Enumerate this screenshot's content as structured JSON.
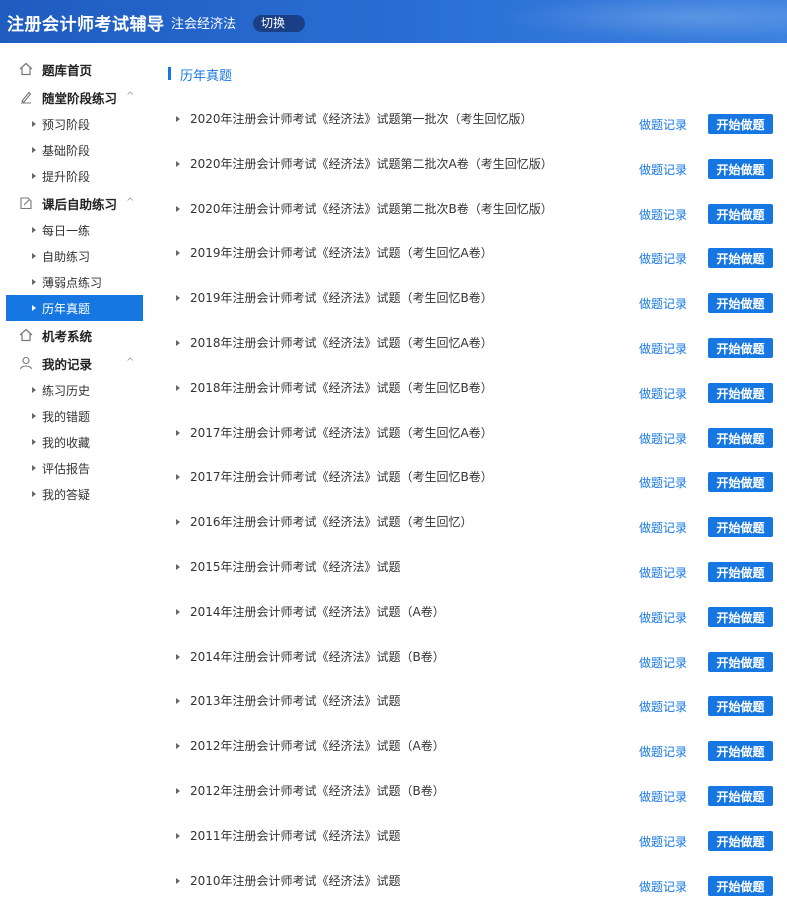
{
  "header": {
    "app_title": "注册会计师考试辅导",
    "subject": "注会经济法",
    "switch_label": "切换"
  },
  "sidebar": {
    "home": {
      "label": "题库首页",
      "icon": "home-icon"
    },
    "groups": [
      {
        "label": "随堂阶段练习",
        "icon": "pen-icon",
        "caret": "^",
        "items": [
          "预习阶段",
          "基础阶段",
          "提升阶段"
        ]
      },
      {
        "label": "课后自助练习",
        "icon": "edit-icon",
        "caret": "^",
        "items": [
          "每日一练",
          "自助练习",
          "薄弱点练习",
          "历年真题"
        ]
      }
    ],
    "exam_system": {
      "label": "机考系统",
      "icon": "home-icon"
    },
    "records": {
      "label": "我的记录",
      "icon": "user-icon",
      "caret": "^",
      "items": [
        "练习历史",
        "我的错题",
        "我的收藏",
        "评估报告",
        "我的答疑"
      ]
    },
    "active_item": "历年真题"
  },
  "main": {
    "section_title": "历年真题",
    "record_label": "做题记录",
    "start_label": "开始做题",
    "exams": [
      "2020年注册会计师考试《经济法》试题第一批次（考生回忆版）",
      "2020年注册会计师考试《经济法》试题第二批次A卷（考生回忆版）",
      "2020年注册会计师考试《经济法》试题第二批次B卷（考生回忆版）",
      "2019年注册会计师考试《经济法》试题（考生回忆A卷）",
      "2019年注册会计师考试《经济法》试题（考生回忆B卷）",
      "2018年注册会计师考试《经济法》试题（考生回忆A卷）",
      "2018年注册会计师考试《经济法》试题（考生回忆B卷）",
      "2017年注册会计师考试《经济法》试题（考生回忆A卷）",
      "2017年注册会计师考试《经济法》试题（考生回忆B卷）",
      "2016年注册会计师考试《经济法》试题（考生回忆）",
      "2015年注册会计师考试《经济法》试题",
      "2014年注册会计师考试《经济法》试题（A卷）",
      "2014年注册会计师考试《经济法》试题（B卷）",
      "2013年注册会计师考试《经济法》试题",
      "2012年注册会计师考试《经济法》试题（A卷）",
      "2012年注册会计师考试《经济法》试题（B卷）",
      "2011年注册会计师考试《经济法》试题",
      "2010年注册会计师考试《经济法》试题"
    ]
  },
  "colors": {
    "accent": "#1677e3",
    "header": "#1f5cc0"
  }
}
